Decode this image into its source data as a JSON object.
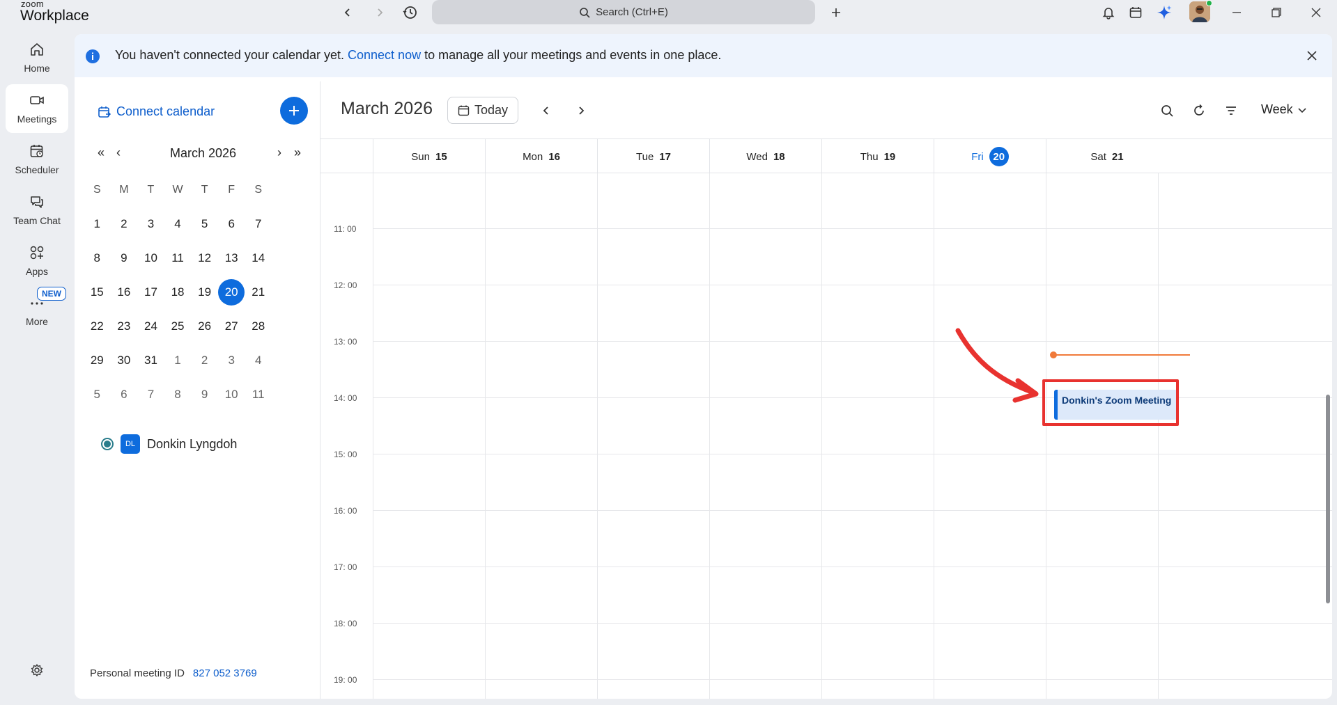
{
  "app": {
    "brand_small": "zoom",
    "brand_big": "Workplace"
  },
  "titlebar": {
    "search_placeholder": "Search (Ctrl+E)"
  },
  "rail": {
    "items": [
      {
        "label": "Home",
        "icon": "home-icon"
      },
      {
        "label": "Meetings",
        "icon": "video-icon"
      },
      {
        "label": "Scheduler",
        "icon": "scheduler-icon"
      },
      {
        "label": "Team Chat",
        "icon": "chat-icon"
      },
      {
        "label": "Apps",
        "icon": "apps-icon"
      },
      {
        "label": "More",
        "icon": "more-icon"
      }
    ],
    "new_badge": "NEW"
  },
  "banner": {
    "text_before": "You haven't connected your calendar yet. ",
    "link": "Connect now",
    "text_after": " to manage all your meetings and events in one place."
  },
  "sidebar": {
    "connect_label": "Connect calendar",
    "mini_title": "March 2026",
    "weekdays": [
      "S",
      "M",
      "T",
      "W",
      "T",
      "F",
      "S"
    ],
    "weeks": [
      [
        "1",
        "2",
        "3",
        "4",
        "5",
        "6",
        "7"
      ],
      [
        "8",
        "9",
        "10",
        "11",
        "12",
        "13",
        "14"
      ],
      [
        "15",
        "16",
        "17",
        "18",
        "19",
        "20",
        "21"
      ],
      [
        "22",
        "23",
        "24",
        "25",
        "26",
        "27",
        "28"
      ],
      [
        "29",
        "30",
        "31",
        "1",
        "2",
        "3",
        "4"
      ],
      [
        "5",
        "6",
        "7",
        "8",
        "9",
        "10",
        "11"
      ]
    ],
    "selected_day": "20",
    "person": {
      "initials": "DL",
      "name": "Donkin Lyngdoh"
    },
    "pmi_label": "Personal meeting ID",
    "pmi_value": "827 052 3769"
  },
  "calendar": {
    "title": "March 2026",
    "today_label": "Today",
    "view_label": "Week",
    "days": [
      {
        "name": "Sun",
        "num": "15"
      },
      {
        "name": "Mon",
        "num": "16"
      },
      {
        "name": "Tue",
        "num": "17"
      },
      {
        "name": "Wed",
        "num": "18"
      },
      {
        "name": "Thu",
        "num": "19"
      },
      {
        "name": "Fri",
        "num": "20"
      },
      {
        "name": "Sat",
        "num": "21"
      }
    ],
    "times": [
      "11: 00",
      "12: 00",
      "13: 00",
      "14: 00",
      "15: 00",
      "16: 00",
      "17: 00",
      "18: 00",
      "19: 00"
    ],
    "event": {
      "title": "Donkin's Zoom Meeting"
    }
  },
  "colors": {
    "accent": "#0e6cdd",
    "annotation": "#e8322f",
    "now_line": "#f07a3a"
  }
}
